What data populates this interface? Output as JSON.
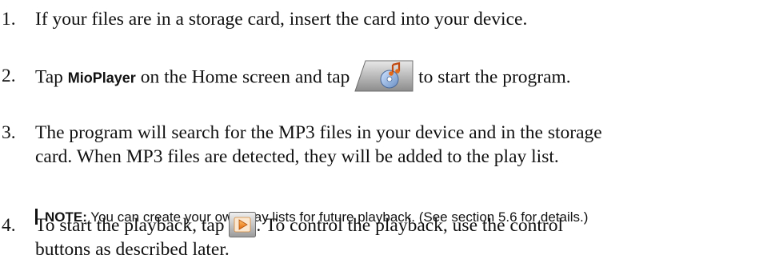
{
  "steps": [
    {
      "number": "1.",
      "text": "If your files are in a storage card, insert the card into your device."
    },
    {
      "number": "2.",
      "before": "Tap ",
      "bold": "MioPlayer",
      "middle": " on the Home screen and tap ",
      "after": " to start the program.",
      "icon": "mioplayer-app-icon"
    },
    {
      "number": "3.",
      "line1": "The program will search for the MP3 files in your device and in the storage",
      "line2": "card. When MP3 files are detected, they will be added to the play list."
    },
    {
      "number": "4.",
      "before": "To start the playback, tap ",
      "after": ". To control the playback, use the control",
      "line2": "buttons as described later.",
      "icon": "play-button-icon"
    }
  ],
  "note": {
    "label": "NOTE:",
    "text": " You can create your own play lists for future playback. (See section 5.6 for details.)"
  }
}
